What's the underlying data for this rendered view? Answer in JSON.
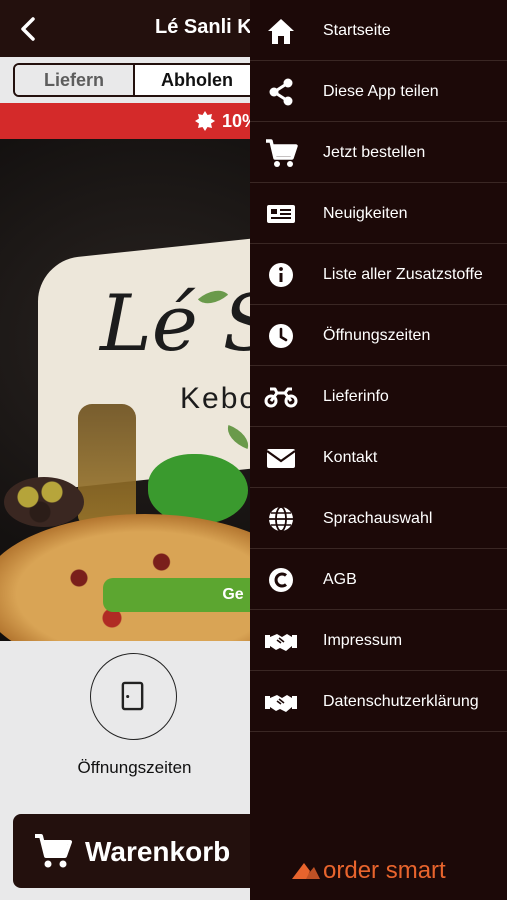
{
  "topbar": {
    "title": "Lé Sanli Ke"
  },
  "order_mode": {
    "deliver": "Liefern",
    "pickup": "Abholen"
  },
  "promo": {
    "text": "10%"
  },
  "hero": {
    "logo": "Lé S",
    "logo_sub": "Kebo",
    "cta": "Ge"
  },
  "tiles": [
    {
      "label": "Öffnungszeiten",
      "icon": "door-icon"
    }
  ],
  "cart": {
    "label": "Warenkorb"
  },
  "menu": [
    {
      "label": "Startseite",
      "icon": "home-icon"
    },
    {
      "label": "Diese App teilen",
      "icon": "share-icon"
    },
    {
      "label": "Jetzt bestellen",
      "icon": "cart-icon"
    },
    {
      "label": "Neuigkeiten",
      "icon": "newspaper-icon"
    },
    {
      "label": "Liste aller Zusatzstoffe",
      "icon": "info-icon"
    },
    {
      "label": "Öffnungszeiten",
      "icon": "clock-icon"
    },
    {
      "label": "Lieferinfo",
      "icon": "motorcycle-icon"
    },
    {
      "label": "Kontakt",
      "icon": "envelope-icon"
    },
    {
      "label": "Sprachauswahl",
      "icon": "globe-icon"
    },
    {
      "label": "AGB",
      "icon": "copyright-icon"
    },
    {
      "label": "Impressum",
      "icon": "handshake-icon"
    },
    {
      "label": "Datenschutzerklärung",
      "icon": "handshake-icon"
    }
  ],
  "brand": {
    "name": "order smart",
    "color": "#e8642d"
  },
  "colors": {
    "drawer_bg": "#1c0908",
    "promo": "#d42a2a",
    "cta": "#5ca630"
  }
}
